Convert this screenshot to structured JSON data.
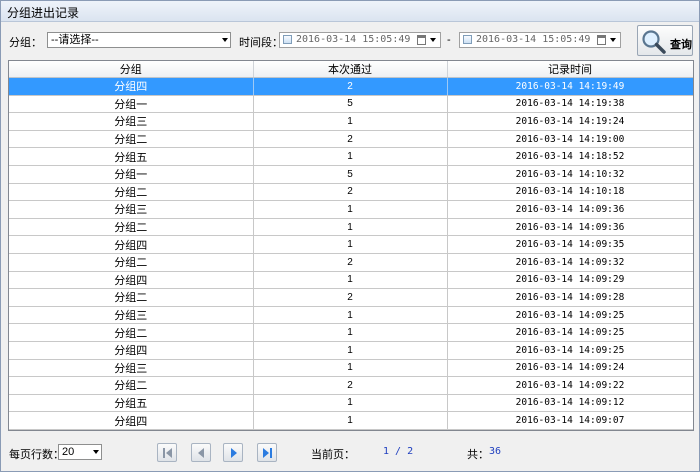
{
  "window": {
    "title": "分组进出记录"
  },
  "filters": {
    "group_label": "分组：",
    "group_value": "--请选择--",
    "period_label": "时间段：",
    "start_time": "2016-03-14 15:05:49",
    "separator": "-",
    "end_time": "2016-03-14 15:05:49",
    "query_button": "查询"
  },
  "table": {
    "columns": [
      "分组",
      "本次通过",
      "记录时间"
    ],
    "rows": [
      [
        "分组四",
        "2",
        "2016-03-14 14:19:49"
      ],
      [
        "分组一",
        "5",
        "2016-03-14 14:19:38"
      ],
      [
        "分组三",
        "1",
        "2016-03-14 14:19:24"
      ],
      [
        "分组二",
        "2",
        "2016-03-14 14:19:00"
      ],
      [
        "分组五",
        "1",
        "2016-03-14 14:18:52"
      ],
      [
        "分组一",
        "5",
        "2016-03-14 14:10:32"
      ],
      [
        "分组二",
        "2",
        "2016-03-14 14:10:18"
      ],
      [
        "分组三",
        "1",
        "2016-03-14 14:09:36"
      ],
      [
        "分组二",
        "1",
        "2016-03-14 14:09:36"
      ],
      [
        "分组四",
        "1",
        "2016-03-14 14:09:35"
      ],
      [
        "分组二",
        "2",
        "2016-03-14 14:09:32"
      ],
      [
        "分组四",
        "1",
        "2016-03-14 14:09:29"
      ],
      [
        "分组二",
        "2",
        "2016-03-14 14:09:28"
      ],
      [
        "分组三",
        "1",
        "2016-03-14 14:09:25"
      ],
      [
        "分组二",
        "1",
        "2016-03-14 14:09:25"
      ],
      [
        "分组四",
        "1",
        "2016-03-14 14:09:25"
      ],
      [
        "分组三",
        "1",
        "2016-03-14 14:09:24"
      ],
      [
        "分组二",
        "2",
        "2016-03-14 14:09:22"
      ],
      [
        "分组五",
        "1",
        "2016-03-14 14:09:12"
      ],
      [
        "分组四",
        "1",
        "2016-03-14 14:09:07"
      ]
    ],
    "selected_row": 0
  },
  "footer": {
    "rows_per_page_label": "每页行数：",
    "rows_per_page_value": "20",
    "current_page_label": "当前页：",
    "current_page_value": "1 / 2",
    "total_label": "共：",
    "total_value": "36"
  },
  "icons": {
    "query": "magnifier-icon",
    "first": "first-page-icon",
    "prev": "prev-page-icon",
    "next": "next-page-icon",
    "last": "last-page-icon"
  },
  "colors": {
    "selection": "#3399ff",
    "page_text": "#1f3fbf"
  }
}
